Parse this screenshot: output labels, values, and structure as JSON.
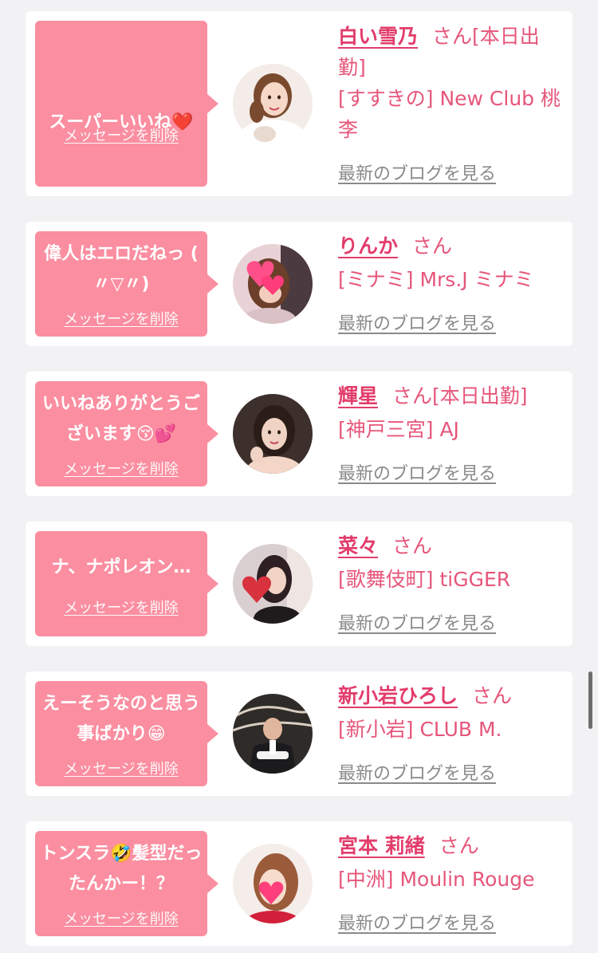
{
  "items": [
    {
      "message": "スーパーいいね",
      "message_emoji": "❤️",
      "delete_label": "メッセージを削除",
      "name": "白い雪乃",
      "honorific": "さん",
      "status": "[本日出勤]",
      "shop": "[すすきの] New Club 桃李",
      "blog_label": "最新のブログを見る",
      "avatar_icon": "woman-portrait-white-dress"
    },
    {
      "message": "偉人はエロだねっ ( 〃▽〃)",
      "delete_label": "メッセージを削除",
      "name": "りんか",
      "honorific": "さん",
      "status": "",
      "shop": "[ミナミ] Mrs.J ミナミ",
      "blog_label": "最新のブログを見る",
      "avatar_icon": "woman-with-heart-stickers"
    },
    {
      "message": "いいねありがとうございます😚💕",
      "delete_label": "メッセージを削除",
      "name": "輝星",
      "honorific": "さん",
      "status": "[本日出勤]",
      "shop": "[神戸三宮] AJ",
      "blog_label": "最新のブログを見る",
      "avatar_icon": "woman-portrait-dark-hair"
    },
    {
      "message": "ナ、ナポレオン…",
      "delete_label": "メッセージを削除",
      "name": "菜々",
      "honorific": "さん",
      "status": "",
      "shop": "[歌舞伎町] tiGGER",
      "blog_label": "最新のブログを見る",
      "avatar_icon": "woman-with-heart-balloon"
    },
    {
      "message": "えーそうなのと思う事ばかり😁",
      "delete_label": "メッセージを削除",
      "name": "新小岩ひろし",
      "honorific": "さん",
      "status": "",
      "shop": "[新小岩] CLUB M.",
      "blog_label": "最新のブログを見る",
      "avatar_icon": "man-in-suit-arms-crossed"
    },
    {
      "message": "トンスラ🤣髪型だったんかー！？",
      "delete_label": "メッセージを削除",
      "name": "宮本 莉緒",
      "honorific": "さん",
      "status": "",
      "shop": "[中洲] Moulin Rouge",
      "blog_label": "最新のブログを見る",
      "avatar_icon": "woman-with-heart-sticker-face"
    }
  ],
  "colors": {
    "background": "#f2f2f4",
    "bubble": "#fb8ea0",
    "name": "#e23d6b",
    "shop_text": "#e6567a",
    "blog_link": "#8a8a8a"
  },
  "scrollbar_icon": "scrollbar-thumb"
}
